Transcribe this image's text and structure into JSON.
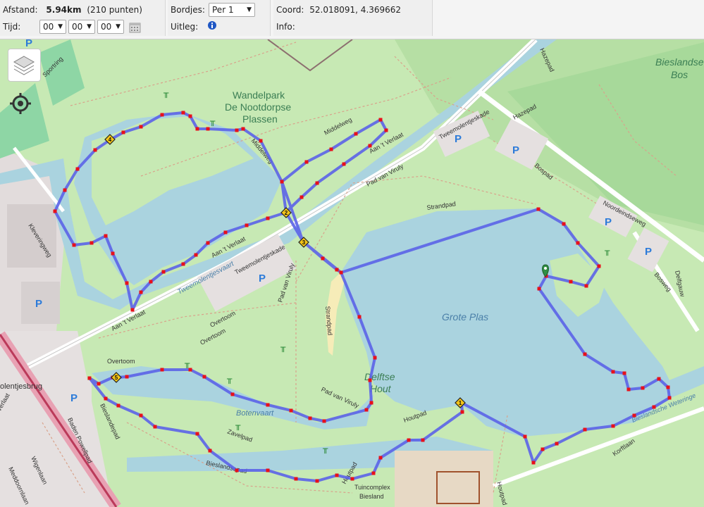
{
  "toolbar": {
    "distance_label": "Afstand:",
    "distance_value": "5.94km",
    "points": "(210 punten)",
    "time_label": "Tijd:",
    "time_hours": "00",
    "time_minutes": "00",
    "time_seconds": "00",
    "signs_label": "Bordjes:",
    "signs_value": "Per 1",
    "explain_label": "Uitleg:",
    "coord_label": "Coord:",
    "coord_value": "52.018091, 4.369662",
    "info_label": "Info:"
  },
  "map": {
    "lake_label": "Grote Plas",
    "markers": [
      "1",
      "2",
      "3",
      "4",
      "5"
    ],
    "labels": {
      "wandelpark1": "Wandelpark",
      "wandelpark2": "De Nootdorpse",
      "wandelpark3": "Plassen",
      "bieslandse1": "Bieslandse",
      "bieslandse2": "Bos",
      "delftse1": "Delftse",
      "delftse2": "Hout",
      "sportring": "Sportring",
      "middelweg": "Middelweg",
      "middelweg2": "Middelweg",
      "aanverlaat1": "Aan 't Verlaat",
      "aanverlaat2": "Aan 't Verlaat",
      "aanverlaat3": "Aan 't Verlaat",
      "padvanviruly1": "Pad van Viruly",
      "padvanviruly2": "Pad van Viruly",
      "padvanviruly3": "Pad van Viruly",
      "tweemolen1": "Tweemolentjeskade",
      "tweemolen2": "Tweemolentjeskade",
      "tweemolentjesvaart": "Tweemolentjesvaart",
      "strandpad1": "Strandpad",
      "strandpad2": "Strandpad",
      "kleveringweg": "Kleveringweg",
      "overtoom1": "Overtoom",
      "overtoom2": "Overtoom",
      "overtoom3": "Overtoom",
      "molentjesbrug": "olentjesbrug",
      "botenvaart": "Botenvaart",
      "zavelpad": "Zavelpad",
      "bieslandsepad": "Bieslandsepad",
      "houtpad1": "Houtpad",
      "houtpad2": "Houtpad",
      "houtpad3": "Houtpad",
      "tuincomplex1": "Tuincomplex",
      "tuincomplex2": "Biesland",
      "noordeindseweg": "Noordeindseweg",
      "bosweg": "Bosweg",
      "bospad": "Bospad",
      "hazepad1": "Hazepad",
      "hazepad2": "Hazepad",
      "delftgauw": "Delfgauw",
      "korftlaan": "Korftlaan",
      "bieslandsewetering": "Bieslandsche Weteringe",
      "badenpowellpad": "Baden Powellpad",
      "meddoorn": "Meddoornlaan",
      "wigenlaan": "Wigenlaan",
      "bieslandepad2": "Bieslandepad",
      "verlaat_left": "Verlaat"
    }
  },
  "colors": {
    "route": "#5b63e8",
    "point": "#e8101a",
    "water": "#aad3df",
    "park": "#c8ebb0",
    "grass": "#a9dd9e",
    "marker": "#f5c518",
    "pin": "#2f8f43"
  }
}
